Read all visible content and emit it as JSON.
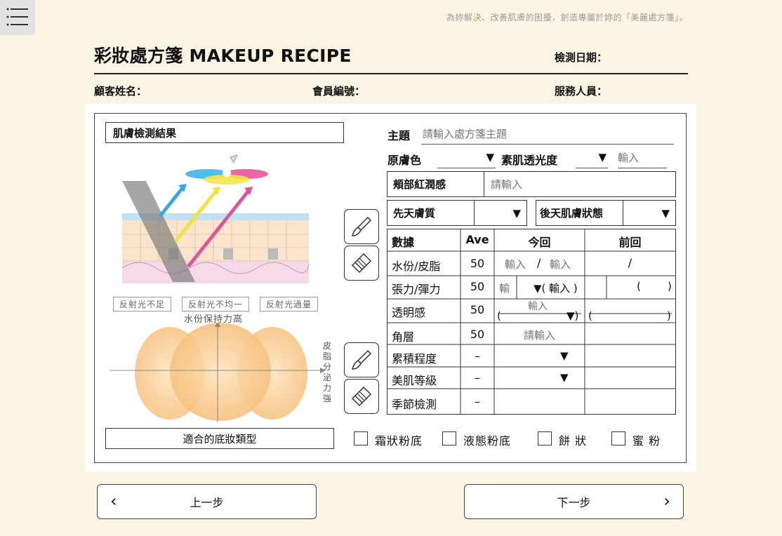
{
  "header": {
    "tagline": "為妳解決、改善肌膚的困擾，創造專屬於妳的「美麗處方箋」。",
    "title": "彩妝處方箋 MAKEUP RECIPE",
    "date_label": "檢測日期：",
    "customer_label": "顧客姓名：",
    "member_label": "會員編號：",
    "staff_label": "服務人員："
  },
  "left": {
    "section_title": "肌膚檢測結果",
    "tags": [
      "反射光不足",
      "反射光不均一",
      "反射光過量"
    ],
    "axis_top": "水份保持力高",
    "axis_right": "皮脂分泌力強",
    "foundation_title": "適合的底妝類型"
  },
  "form": {
    "topic_label": "主題",
    "topic_placeholder": "請輸入處方箋主題",
    "skin_color_label": "原膚色",
    "transparency_label": "素肌透光度",
    "transparency_placeholder": "輸入",
    "cheek_label": "頰部紅潤感",
    "cheek_placeholder": "請輸入",
    "innate_label": "先天膚質",
    "acquired_label": "後天肌膚狀態",
    "dropdown_glyph": "▼"
  },
  "table": {
    "headers": [
      "數據",
      "Ave",
      "今回",
      "前回"
    ],
    "rows": [
      {
        "label": "水份/皮脂",
        "ave": "50"
      },
      {
        "label": "張力/彈力",
        "ave": "50"
      },
      {
        "label": "透明感",
        "ave": "50"
      },
      {
        "label": "角層",
        "ave": "50"
      },
      {
        "label": "累積程度",
        "ave": "–"
      },
      {
        "label": "美肌等級",
        "ave": "–"
      },
      {
        "label": "季節檢測",
        "ave": "–"
      }
    ],
    "r1_input_a": "輸入",
    "r1_slash": "/",
    "r1_input_b": "輸入",
    "r1_prev": "/",
    "r2_input": "輸",
    "r2_dd": "▼( 輸入 )",
    "r2_prev": "(        )",
    "r3_input": "輸入",
    "r3_open": "(",
    "r3_dd": "▼)",
    "r3_prev_open": "(",
    "r3_prev_close": ")",
    "r4_input": "請輸入"
  },
  "foundation_options": [
    "霜狀粉底",
    "液態粉底",
    "餅 狀",
    "蜜 粉"
  ],
  "nav": {
    "prev_label": "上一步",
    "next_label": "下一步",
    "prev_glyph": "‹",
    "next_glyph": "›"
  }
}
